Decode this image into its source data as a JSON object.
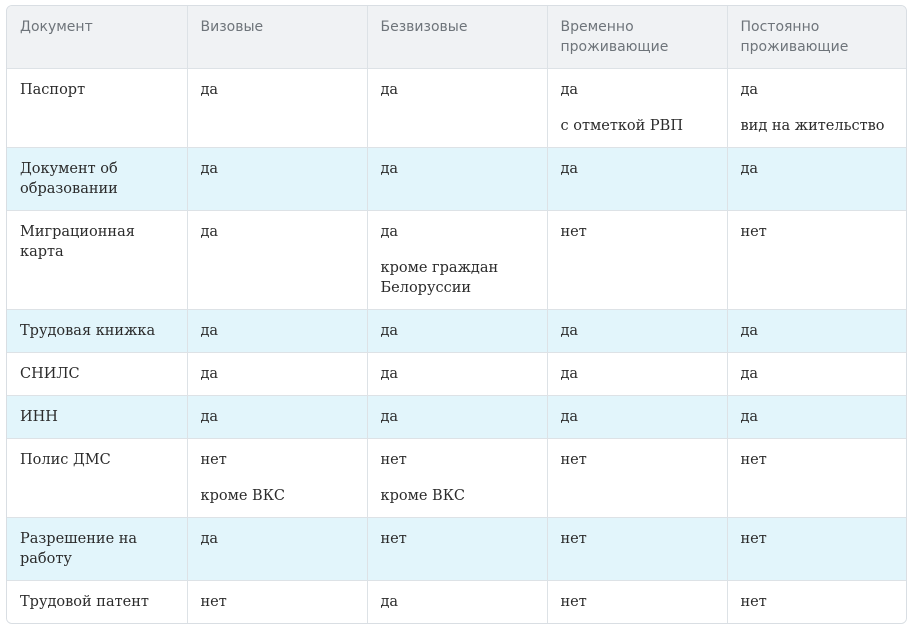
{
  "table": {
    "headers": [
      "Документ",
      "Визовые",
      "Безвизовые",
      "Временно проживающие",
      "Постоянно проживающие"
    ],
    "rows": [
      {
        "cells": [
          {
            "value": "Паспорт"
          },
          {
            "value": "да"
          },
          {
            "value": "да"
          },
          {
            "value": "да",
            "note": "с отметкой РВП"
          },
          {
            "value": "да",
            "note": "вид на жительство"
          }
        ]
      },
      {
        "cells": [
          {
            "value": "Документ об образовании"
          },
          {
            "value": "да"
          },
          {
            "value": "да"
          },
          {
            "value": "да"
          },
          {
            "value": "да"
          }
        ]
      },
      {
        "cells": [
          {
            "value": "Миграционная карта"
          },
          {
            "value": "да"
          },
          {
            "value": "да",
            "note": "кроме граждан Белоруссии"
          },
          {
            "value": "нет"
          },
          {
            "value": "нет"
          }
        ]
      },
      {
        "cells": [
          {
            "value": "Трудовая книжка"
          },
          {
            "value": "да"
          },
          {
            "value": "да"
          },
          {
            "value": "да"
          },
          {
            "value": "да"
          }
        ]
      },
      {
        "cells": [
          {
            "value": "СНИЛС"
          },
          {
            "value": "да"
          },
          {
            "value": "да"
          },
          {
            "value": "да"
          },
          {
            "value": "да"
          }
        ]
      },
      {
        "cells": [
          {
            "value": "ИНН"
          },
          {
            "value": "да"
          },
          {
            "value": "да"
          },
          {
            "value": "да"
          },
          {
            "value": "да"
          }
        ]
      },
      {
        "cells": [
          {
            "value": "Полис ДМС"
          },
          {
            "value": "нет",
            "note": "кроме ВКС"
          },
          {
            "value": "нет",
            "note": "кроме ВКС"
          },
          {
            "value": "нет"
          },
          {
            "value": "нет"
          }
        ]
      },
      {
        "cells": [
          {
            "value": "Разрешение на работу"
          },
          {
            "value": "да"
          },
          {
            "value": "нет"
          },
          {
            "value": "нет"
          },
          {
            "value": "нет"
          }
        ]
      },
      {
        "cells": [
          {
            "value": "Трудовой патент"
          },
          {
            "value": "нет"
          },
          {
            "value": "да"
          },
          {
            "value": "нет"
          },
          {
            "value": "нет"
          }
        ]
      }
    ]
  },
  "colors": {
    "header_bg": "#f0f2f4",
    "header_text": "#6e747a",
    "alt_row_bg": "#e2f5fb",
    "row_bg": "#ffffff",
    "border": "#dde2e6",
    "text": "#2b2b2b"
  }
}
